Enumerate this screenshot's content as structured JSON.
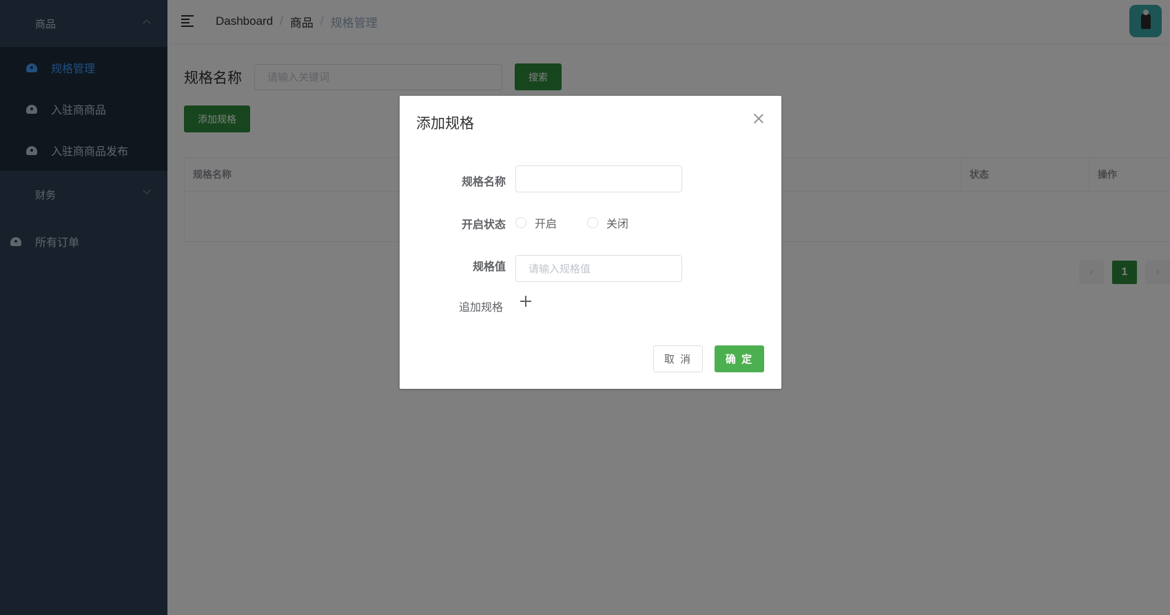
{
  "sidebar": {
    "group_goods": "商品",
    "items": [
      {
        "label": "规格管理",
        "active": true
      },
      {
        "label": "入驻商商品"
      },
      {
        "label": "入驻商商品发布"
      }
    ],
    "group_finance": "财务",
    "all_orders": "所有订单"
  },
  "navbar": {
    "breadcrumb": [
      "Dashboard",
      "商品",
      "规格管理"
    ],
    "separator": "/"
  },
  "search": {
    "label": "规格名称",
    "placeholder": "请输入关键词",
    "button": "搜索"
  },
  "add_button": "添加规格",
  "table": {
    "columns": [
      "规格名称",
      "状态",
      "操作"
    ]
  },
  "pagination": {
    "prev": "‹",
    "page": "1",
    "next": "›"
  },
  "dialog": {
    "title": "添加规格",
    "name_label": "规格名称",
    "status_label": "开启状态",
    "status_on": "开启",
    "status_off": "关闭",
    "value_label": "规格值",
    "value_placeholder": "请输入规格值",
    "add_spec": "追加规格",
    "cancel": "取 消",
    "confirm": "确 定"
  },
  "colors": {
    "sidebar_bg": "#304156",
    "active": "#409eff",
    "primary_green": "#2e8b3a",
    "confirm_green": "#4caf50"
  }
}
